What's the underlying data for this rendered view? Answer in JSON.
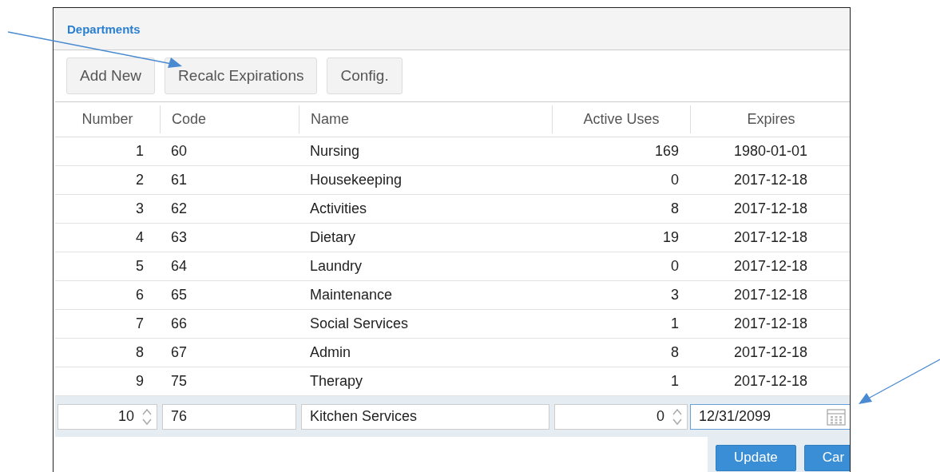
{
  "panel": {
    "title": "Departments"
  },
  "toolbar": {
    "buttons": [
      "Add New",
      "Recalc Expirations",
      "Config."
    ]
  },
  "table": {
    "columns": [
      "Number",
      "Code",
      "Name",
      "Active Uses",
      "Expires"
    ],
    "rows": [
      {
        "number": "1",
        "code": "60",
        "name": "Nursing",
        "active_uses": "169",
        "expires": "1980-01-01"
      },
      {
        "number": "2",
        "code": "61",
        "name": "Housekeeping",
        "active_uses": "0",
        "expires": "2017-12-18"
      },
      {
        "number": "3",
        "code": "62",
        "name": "Activities",
        "active_uses": "8",
        "expires": "2017-12-18"
      },
      {
        "number": "4",
        "code": "63",
        "name": "Dietary",
        "active_uses": "19",
        "expires": "2017-12-18"
      },
      {
        "number": "5",
        "code": "64",
        "name": "Laundry",
        "active_uses": "0",
        "expires": "2017-12-18"
      },
      {
        "number": "6",
        "code": "65",
        "name": "Maintenance",
        "active_uses": "3",
        "expires": "2017-12-18"
      },
      {
        "number": "7",
        "code": "66",
        "name": "Social Services",
        "active_uses": "1",
        "expires": "2017-12-18"
      },
      {
        "number": "8",
        "code": "67",
        "name": "Admin",
        "active_uses": "8",
        "expires": "2017-12-18"
      },
      {
        "number": "9",
        "code": "75",
        "name": "Therapy",
        "active_uses": "1",
        "expires": "2017-12-18"
      }
    ],
    "edit_row": {
      "number": "10",
      "code": "76",
      "name": "Kitchen Services",
      "active_uses": "0",
      "expires": "12/31/2099"
    },
    "edit_buttons": [
      "Update",
      "Car"
    ]
  }
}
